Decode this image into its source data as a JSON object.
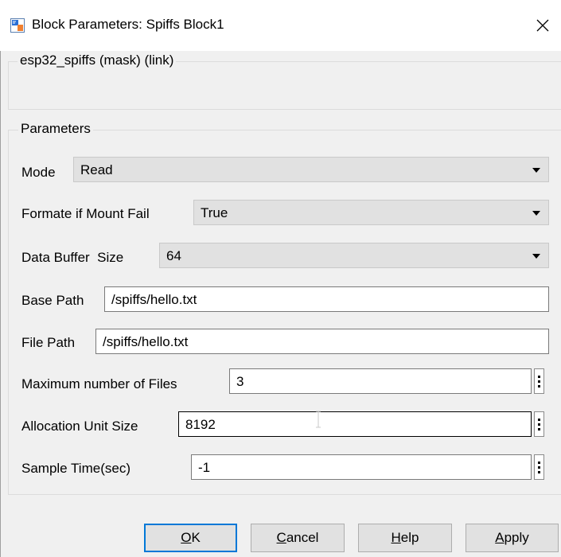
{
  "window": {
    "title": "Block Parameters: Spiffs Block1"
  },
  "mask": {
    "title": "esp32_spiffs (mask) (link)"
  },
  "parameters": {
    "title": "Parameters",
    "mode": {
      "label": "Mode",
      "value": "Read"
    },
    "format_on_fail": {
      "label": "Formate if Mount Fail",
      "value": "True"
    },
    "buffer_size": {
      "label": "Data Buffer  Size",
      "value": "64"
    },
    "base_path": {
      "label": "Base Path",
      "value": "/spiffs/hello.txt"
    },
    "file_path": {
      "label": "File Path",
      "value": "/spiffs/hello.txt"
    },
    "max_files": {
      "label": "Maximum number of Files",
      "value": "3"
    },
    "alloc_unit": {
      "label": "Allocation Unit Size",
      "value": "8192"
    },
    "sample_time": {
      "label": "Sample Time(sec)",
      "value": "-1"
    }
  },
  "buttons": {
    "ok": {
      "mnemonic": "O",
      "rest": "K"
    },
    "cancel": {
      "mnemonic": "C",
      "rest": "ancel"
    },
    "help": {
      "mnemonic": "H",
      "rest": "elp"
    },
    "apply": {
      "mnemonic": "A",
      "rest": "pply"
    }
  }
}
